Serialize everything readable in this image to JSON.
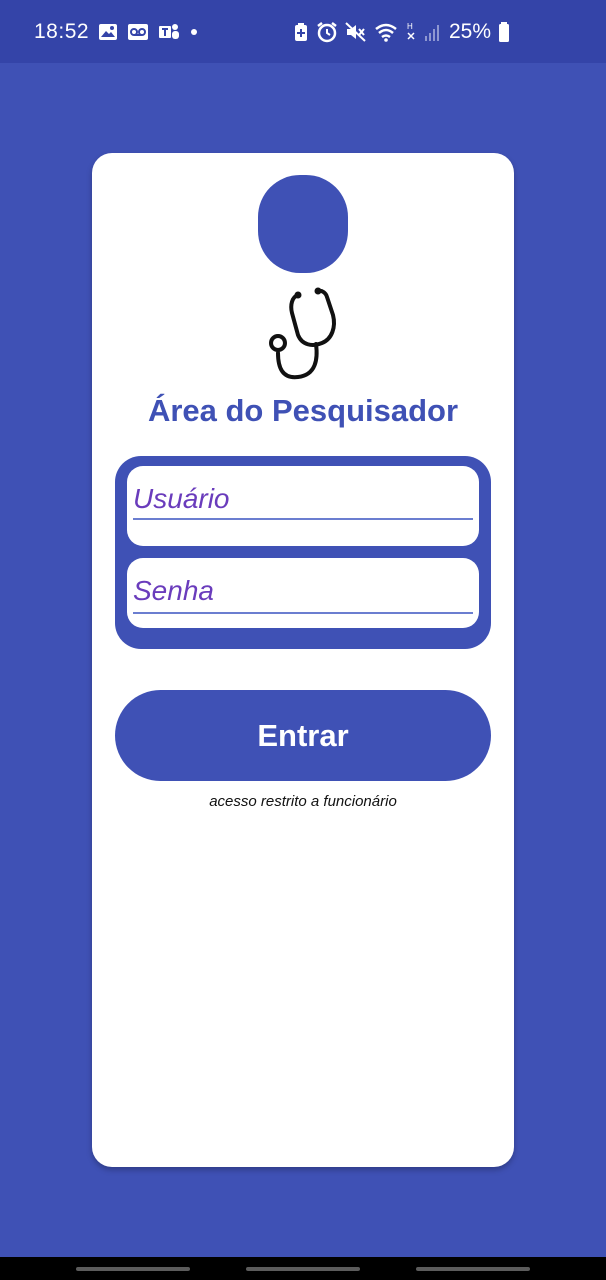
{
  "status_bar": {
    "time": "18:52",
    "left_icons": [
      "gallery-icon",
      "voicemail-icon",
      "teams-icon",
      "dot-icon"
    ],
    "right_icons": [
      "battery-saver-icon",
      "alarm-icon",
      "mute-icon",
      "wifi-icon",
      "nfc-icon",
      "signal-icon"
    ],
    "battery": "25%"
  },
  "login": {
    "title": "Área do Pesquisador",
    "username_placeholder": "Usuário",
    "password_placeholder": "Senha",
    "enter_label": "Entrar",
    "restricted_note": "acesso restrito a funcionário"
  },
  "colors": {
    "primary": "#3f51b5",
    "status_bar": "#3444a8",
    "hint_text": "#6a3cbc"
  }
}
